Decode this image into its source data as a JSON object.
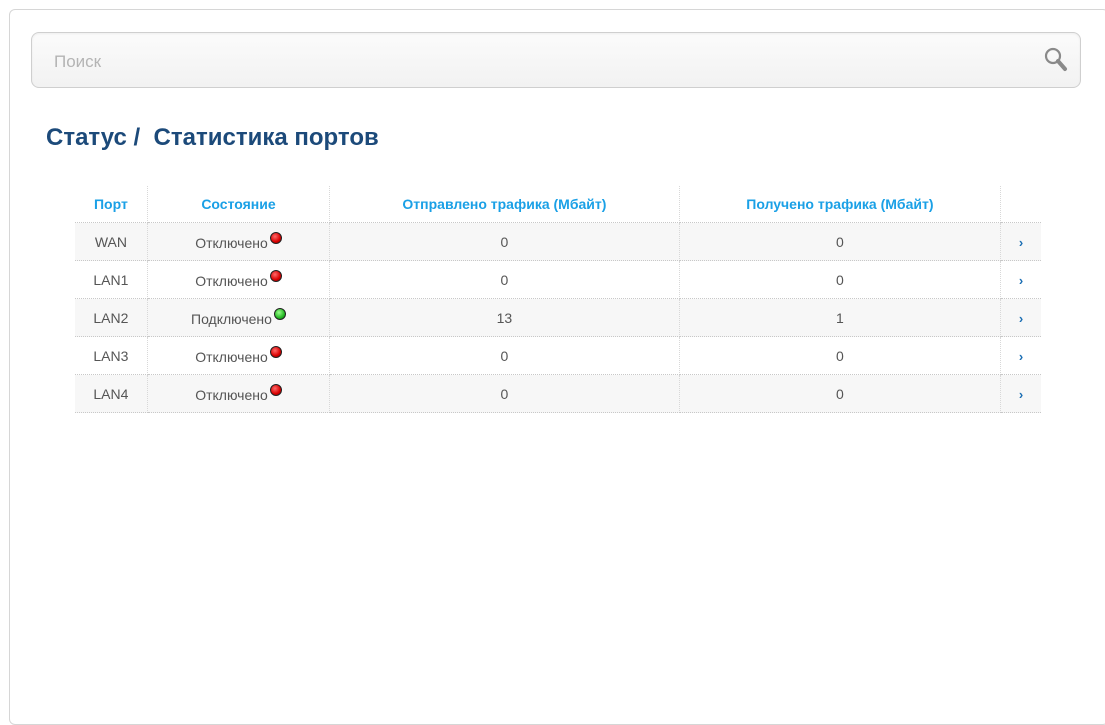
{
  "search": {
    "placeholder": "Поиск"
  },
  "page": {
    "title": "Статус /  Статистика портов"
  },
  "table": {
    "headers": {
      "port": "Порт",
      "state": "Состояние",
      "sent": "Отправлено трафика (Мбайт)",
      "received": "Получено трафика (Мбайт)"
    },
    "rows": [
      {
        "port": "WAN",
        "state": "Отключено",
        "status": "disconnected",
        "sent": "0",
        "received": "0"
      },
      {
        "port": "LAN1",
        "state": "Отключено",
        "status": "disconnected",
        "sent": "0",
        "received": "0"
      },
      {
        "port": "LAN2",
        "state": "Подключено",
        "status": "connected",
        "sent": "13",
        "received": "1"
      },
      {
        "port": "LAN3",
        "state": "Отключено",
        "status": "disconnected",
        "sent": "0",
        "received": "0"
      },
      {
        "port": "LAN4",
        "state": "Отключено",
        "status": "disconnected",
        "sent": "0",
        "received": "0"
      }
    ],
    "row_action_icon": "chevron-right-icon"
  },
  "colors": {
    "title": "#1c4a7a",
    "header": "#1aa0e6",
    "status_connected": "#24b824",
    "status_disconnected": "#d80000",
    "chevron": "#1c6fb4"
  }
}
